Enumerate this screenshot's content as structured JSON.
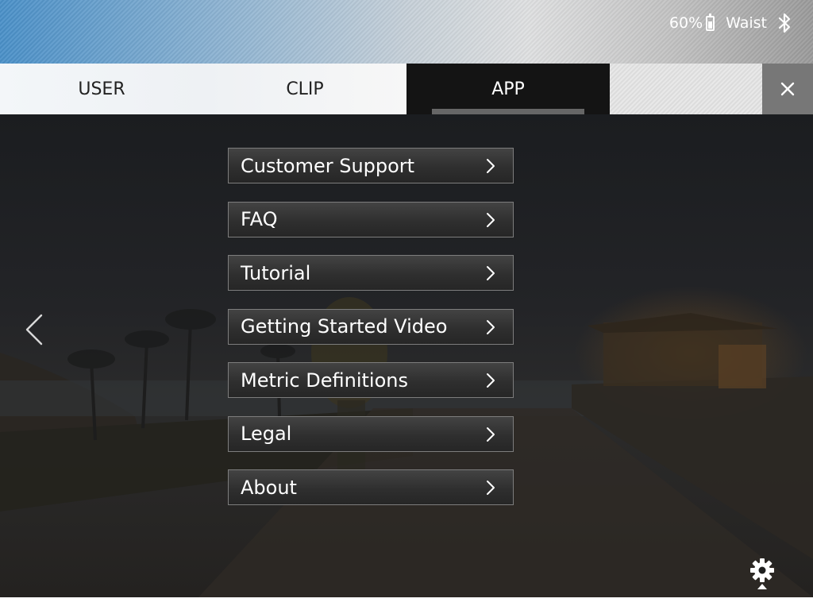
{
  "status_bar": {
    "battery_percent": "60%",
    "battery_level": 0.6,
    "location": "Waist",
    "bluetooth_icon": "bluetooth-icon",
    "battery_icon": "battery-icon"
  },
  "tabs": [
    {
      "label": "USER",
      "active": false
    },
    {
      "label": "CLIP",
      "active": false
    },
    {
      "label": "APP",
      "active": true
    }
  ],
  "close_icon": "close-icon",
  "menu": {
    "items": [
      {
        "label": "Customer Support"
      },
      {
        "label": "FAQ"
      },
      {
        "label": "Tutorial"
      },
      {
        "label": "Getting Started Video"
      },
      {
        "label": "Metric Definitions"
      },
      {
        "label": "Legal"
      },
      {
        "label": "About"
      }
    ],
    "chevron_icon": "chevron-right-icon"
  },
  "navigation": {
    "back_icon": "chevron-left-icon"
  },
  "settings_icon": "gear-icon",
  "colors": {
    "tab_active_bg": "#141414",
    "tab_inactive_bg": "#f2f5f8",
    "close_bg": "#777777",
    "menu_item_border": "#7d7d7d",
    "text_light": "#ffffff",
    "text_dark": "#222222"
  }
}
